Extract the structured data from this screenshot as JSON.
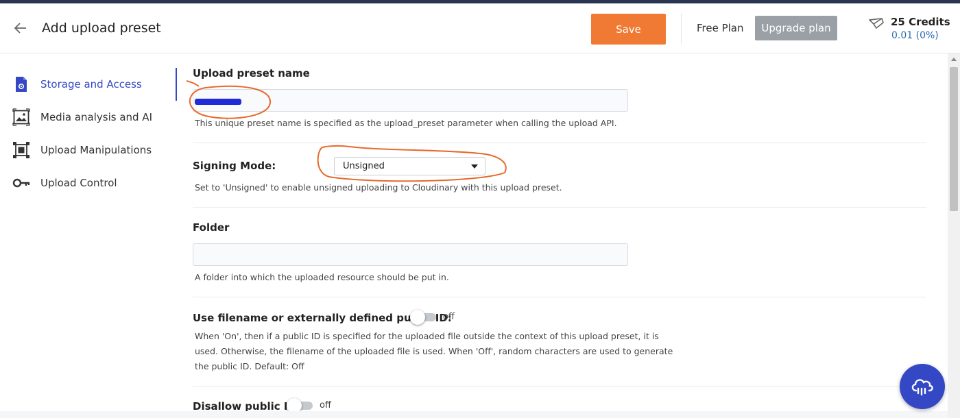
{
  "header": {
    "title": "Add upload preset",
    "save_label": "Save",
    "plan_label": "Free Plan",
    "upgrade_label": "Upgrade plan",
    "credits_title": "25 Credits",
    "credits_usage": "0.01 (0%)"
  },
  "sidebar": {
    "items": [
      {
        "label": "Storage and Access",
        "icon": "file-settings-icon",
        "active": true
      },
      {
        "label": "Media analysis and AI",
        "icon": "image-icon",
        "active": false
      },
      {
        "label": "Upload Manipulations",
        "icon": "crop-frame-icon",
        "active": false
      },
      {
        "label": "Upload Control",
        "icon": "key-icon",
        "active": false
      }
    ]
  },
  "form": {
    "preset_name": {
      "label": "Upload preset name",
      "help": "This unique preset name is specified as the upload_preset parameter when calling the upload API."
    },
    "signing_mode": {
      "label": "Signing Mode:",
      "value": "Unsigned",
      "help": "Set to 'Unsigned' to enable unsigned uploading to Cloudinary with this upload preset."
    },
    "folder": {
      "label": "Folder",
      "value": "",
      "help": "A folder into which the uploaded resource should be put in."
    },
    "use_filename": {
      "label": "Use filename or externally defined public ID:",
      "state": "off",
      "help_lines": [
        "When 'On', then if a public ID is specified for the uploaded file outside the context of this upload preset, it is",
        "used. Otherwise, the filename of the uploaded file is used. When 'Off', random characters are used to generate",
        "the public ID. Default: Off"
      ]
    },
    "disallow_public_id": {
      "label": "Disallow public ID:",
      "state": "off"
    }
  },
  "colors": {
    "accent": "#3448c5",
    "save": "#f07a34",
    "upgrade": "#9aa0a6",
    "annotation": "#e8692c"
  }
}
